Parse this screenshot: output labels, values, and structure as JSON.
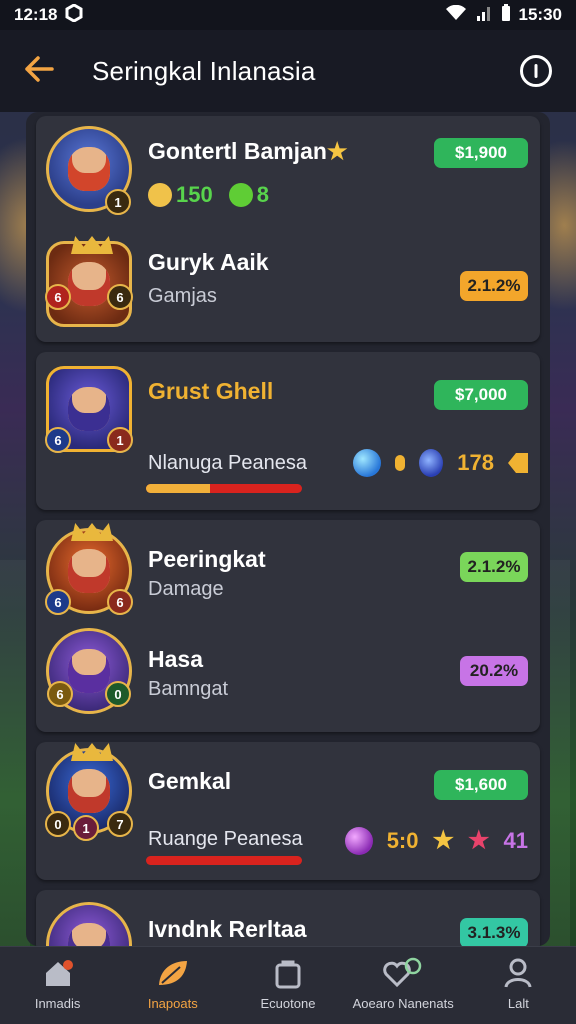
{
  "status_bar": {
    "time_left": "12:18",
    "time_right": "15:30"
  },
  "header": {
    "title": "Seringkal Inlanasia"
  },
  "colors": {
    "accent": "#f3a443",
    "green": "#2fb55b",
    "orange": "#f3a62b",
    "lime": "#7ad65a",
    "purple": "#c774e6",
    "teal": "#33c7a3",
    "red_bar": "#d9231e"
  },
  "cards": [
    {
      "rows": [
        {
          "name": "Gontertl Bamjan",
          "star": "★",
          "badge": "$1,900",
          "badge_color": "#2fb55b",
          "stats": [
            {
              "value": "150"
            },
            {
              "value": "8"
            }
          ]
        },
        {
          "name": "Guryk Aaik",
          "subtitle": "Gamjas",
          "badge": "2.1.2%",
          "badge_color": "#f3a62b"
        }
      ]
    },
    {
      "rows": [
        {
          "name": "Grust Ghell",
          "subtitle": "Nlanuga Peanesa",
          "badge": "$7,000",
          "badge_color": "#2fb55b",
          "progress": 0.41,
          "icons": [
            {
              "value": "0"
            },
            {
              "value": "178"
            }
          ]
        }
      ]
    },
    {
      "rows": [
        {
          "name": "Peeringkat",
          "subtitle": "Damage",
          "badge": "2.1.2%",
          "badge_color": "#7ad65a"
        },
        {
          "name": "Hasa",
          "subtitle": "Bamngat",
          "badge": "20.2%",
          "badge_color": "#c774e6"
        }
      ]
    },
    {
      "rows": [
        {
          "name": "Gemkal",
          "subtitle": "Ruange Peanesa",
          "badge": "$1,600",
          "badge_color": "#2fb55b",
          "progress": 0.0,
          "icons": [
            {
              "value": "5:0"
            },
            {
              "value": "41"
            }
          ]
        }
      ]
    },
    {
      "rows": [
        {
          "name": "Ivndnk Rerltaa",
          "badge": "3.1.3%",
          "badge_color": "#33c7a3"
        }
      ]
    }
  ],
  "nav": [
    {
      "label": "Inmadis",
      "icon": "home-icon"
    },
    {
      "label": "Inapoats",
      "icon": "leaf-icon"
    },
    {
      "label": "Ecuotone",
      "icon": "bag-icon"
    },
    {
      "label": "Aoearo Nanenats",
      "icon": "heart-icon"
    },
    {
      "label": "Lalt",
      "icon": "user-icon"
    }
  ]
}
